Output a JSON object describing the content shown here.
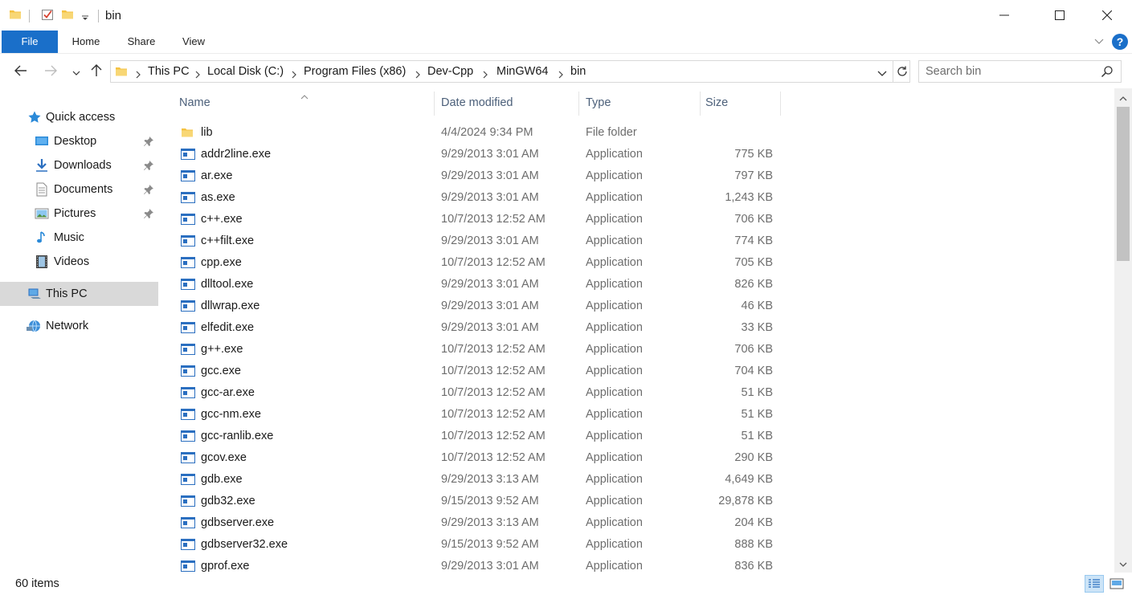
{
  "window": {
    "title": "bin",
    "minimize_icon": "minimize-icon",
    "maximize_icon": "maximize-icon",
    "close_icon": "close-icon"
  },
  "ribbon": {
    "tabs": [
      {
        "label": "File",
        "active": true
      },
      {
        "label": "Home"
      },
      {
        "label": "Share"
      },
      {
        "label": "View"
      }
    ],
    "help_label": "?"
  },
  "address": {
    "crumbs": [
      "This PC",
      "Local Disk (C:)",
      "Program Files (x86)",
      "Dev-Cpp",
      "MinGW64",
      "bin"
    ]
  },
  "search": {
    "placeholder": "Search bin"
  },
  "sidebar": {
    "items": [
      {
        "label": "Quick access",
        "icon": "star-icon"
      },
      {
        "label": "Desktop",
        "icon": "desktop-icon",
        "pinned": true
      },
      {
        "label": "Downloads",
        "icon": "download-icon",
        "pinned": true
      },
      {
        "label": "Documents",
        "icon": "document-icon",
        "pinned": true
      },
      {
        "label": "Pictures",
        "icon": "pictures-icon",
        "pinned": true
      },
      {
        "label": "Music",
        "icon": "music-icon"
      },
      {
        "label": "Videos",
        "icon": "videos-icon"
      },
      {
        "label": "This PC",
        "icon": "computer-icon",
        "selected": true
      },
      {
        "label": "Network",
        "icon": "network-icon"
      }
    ]
  },
  "columns": {
    "name": "Name",
    "date": "Date modified",
    "type": "Type",
    "size": "Size"
  },
  "files": [
    {
      "name": "lib",
      "date": "4/4/2024 9:34 PM",
      "type": "File folder",
      "size": "",
      "icon": "folder-icon"
    },
    {
      "name": "addr2line.exe",
      "date": "9/29/2013 3:01 AM",
      "type": "Application",
      "size": "775 KB",
      "icon": "app-icon"
    },
    {
      "name": "ar.exe",
      "date": "9/29/2013 3:01 AM",
      "type": "Application",
      "size": "797 KB",
      "icon": "app-icon"
    },
    {
      "name": "as.exe",
      "date": "9/29/2013 3:01 AM",
      "type": "Application",
      "size": "1,243 KB",
      "icon": "app-icon"
    },
    {
      "name": "c++.exe",
      "date": "10/7/2013 12:52 AM",
      "type": "Application",
      "size": "706 KB",
      "icon": "app-icon"
    },
    {
      "name": "c++filt.exe",
      "date": "9/29/2013 3:01 AM",
      "type": "Application",
      "size": "774 KB",
      "icon": "app-icon"
    },
    {
      "name": "cpp.exe",
      "date": "10/7/2013 12:52 AM",
      "type": "Application",
      "size": "705 KB",
      "icon": "app-icon"
    },
    {
      "name": "dlltool.exe",
      "date": "9/29/2013 3:01 AM",
      "type": "Application",
      "size": "826 KB",
      "icon": "app-icon"
    },
    {
      "name": "dllwrap.exe",
      "date": "9/29/2013 3:01 AM",
      "type": "Application",
      "size": "46 KB",
      "icon": "app-icon"
    },
    {
      "name": "elfedit.exe",
      "date": "9/29/2013 3:01 AM",
      "type": "Application",
      "size": "33 KB",
      "icon": "app-icon"
    },
    {
      "name": "g++.exe",
      "date": "10/7/2013 12:52 AM",
      "type": "Application",
      "size": "706 KB",
      "icon": "app-icon"
    },
    {
      "name": "gcc.exe",
      "date": "10/7/2013 12:52 AM",
      "type": "Application",
      "size": "704 KB",
      "icon": "app-icon"
    },
    {
      "name": "gcc-ar.exe",
      "date": "10/7/2013 12:52 AM",
      "type": "Application",
      "size": "51 KB",
      "icon": "app-icon"
    },
    {
      "name": "gcc-nm.exe",
      "date": "10/7/2013 12:52 AM",
      "type": "Application",
      "size": "51 KB",
      "icon": "app-icon"
    },
    {
      "name": "gcc-ranlib.exe",
      "date": "10/7/2013 12:52 AM",
      "type": "Application",
      "size": "51 KB",
      "icon": "app-icon"
    },
    {
      "name": "gcov.exe",
      "date": "10/7/2013 12:52 AM",
      "type": "Application",
      "size": "290 KB",
      "icon": "app-icon"
    },
    {
      "name": "gdb.exe",
      "date": "9/29/2013 3:13 AM",
      "type": "Application",
      "size": "4,649 KB",
      "icon": "app-icon"
    },
    {
      "name": "gdb32.exe",
      "date": "9/15/2013 9:52 AM",
      "type": "Application",
      "size": "29,878 KB",
      "icon": "app-icon"
    },
    {
      "name": "gdbserver.exe",
      "date": "9/29/2013 3:13 AM",
      "type": "Application",
      "size": "204 KB",
      "icon": "app-icon"
    },
    {
      "name": "gdbserver32.exe",
      "date": "9/15/2013 9:52 AM",
      "type": "Application",
      "size": "888 KB",
      "icon": "app-icon"
    },
    {
      "name": "gprof.exe",
      "date": "9/29/2013 3:01 AM",
      "type": "Application",
      "size": "836 KB",
      "icon": "app-icon"
    }
  ],
  "status": {
    "item_count": "60 items"
  },
  "colors": {
    "accent": "#1a6fc9",
    "folder": "#f5c242",
    "selected_nav": "#d9d9d9",
    "header_text": "#4c607a"
  }
}
